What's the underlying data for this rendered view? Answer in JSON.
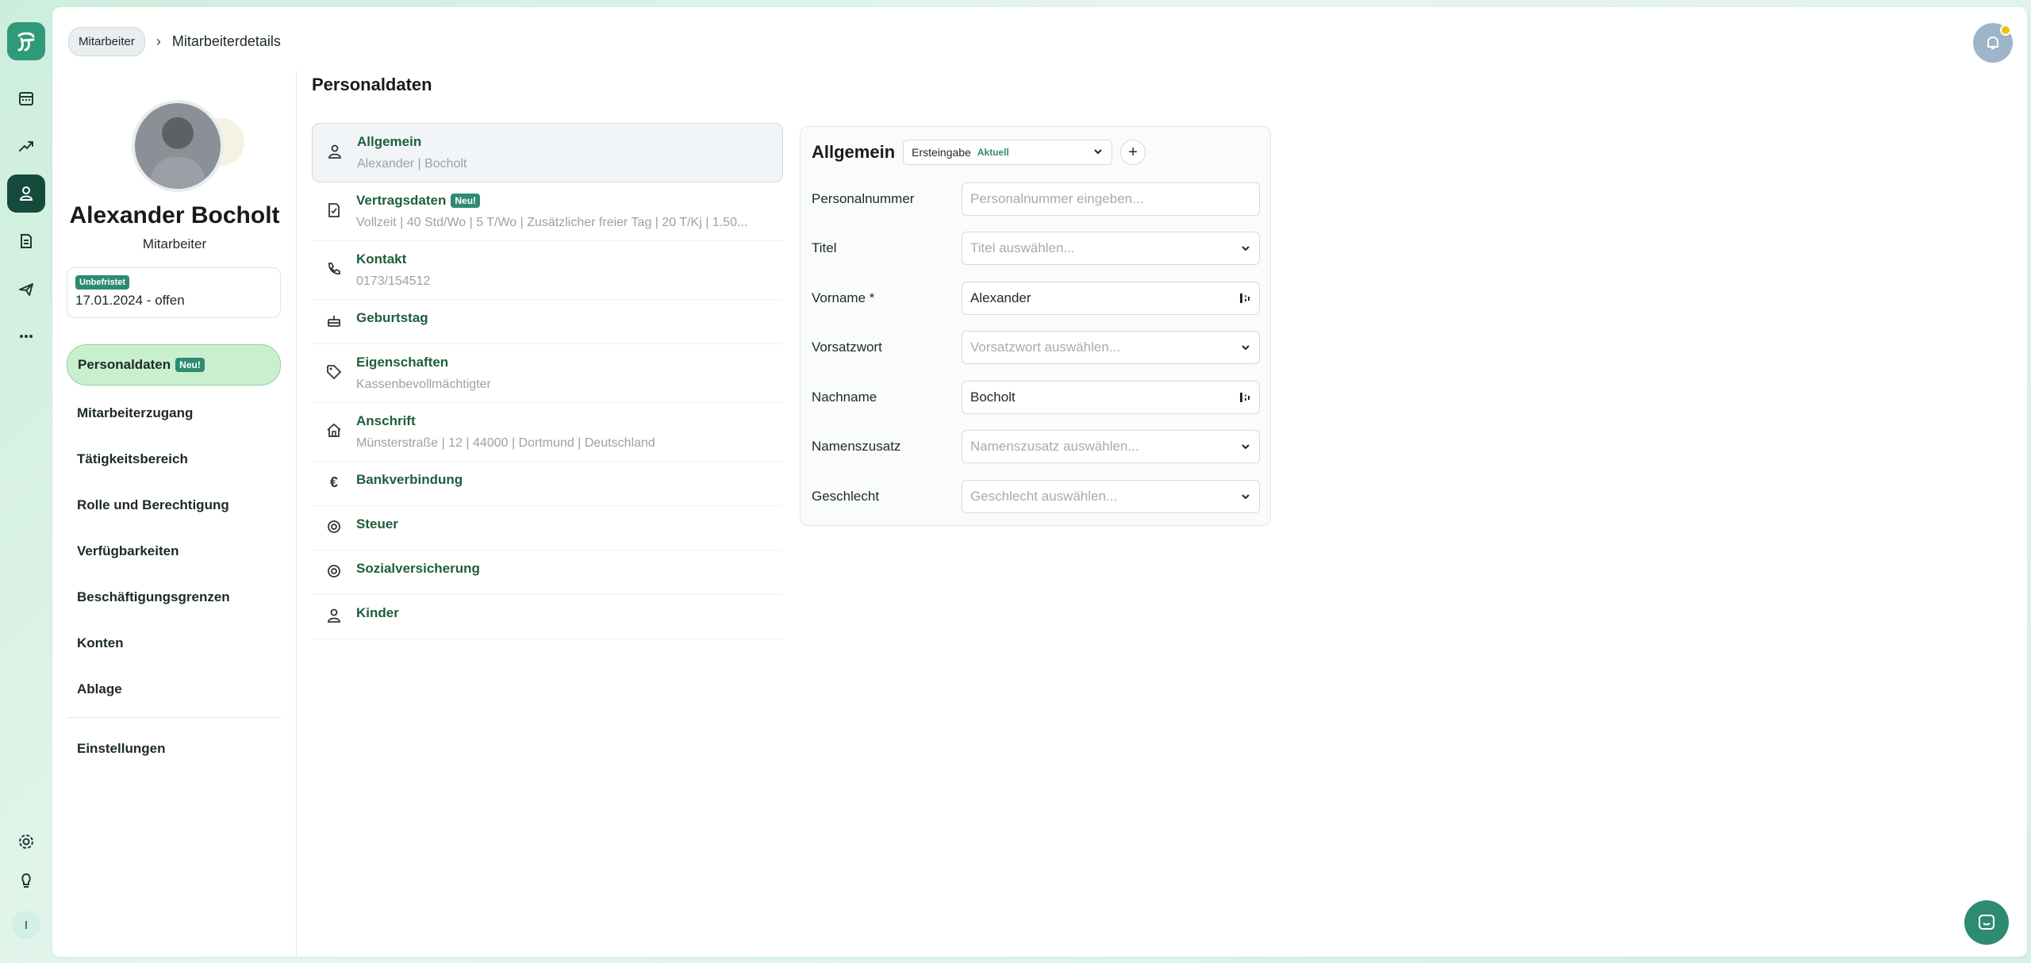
{
  "breadcrumb": {
    "parent": "Mitarbeiter",
    "separator": "›",
    "current": "Mitarbeiterdetails"
  },
  "rail": {
    "items": [
      "calendar-icon",
      "trending-icon",
      "user-icon",
      "document-icon",
      "plane-icon",
      "more-icon"
    ],
    "bottom": [
      "gear-icon",
      "lightbulb-icon"
    ],
    "user_initial": "I"
  },
  "profile": {
    "name": "Alexander Bocholt",
    "role": "Mitarbeiter",
    "contract_badge": "Unbefristet",
    "contract_dates": "17.01.2024 - offen"
  },
  "nav": {
    "active": "Personaldaten",
    "active_badge": "Neu!",
    "items": [
      "Mitarbeiterzugang",
      "Tätigkeitsbereich",
      "Rolle und Berechtigung",
      "Verfügbarkeiten",
      "Beschäftigungsgrenzen",
      "Konten",
      "Ablage"
    ],
    "settings": "Einstellungen"
  },
  "section": {
    "title": "Personaldaten",
    "rows": [
      {
        "title": "Allgemein",
        "subtitle": "Alexander | Bocholt"
      },
      {
        "title": "Vertragsdaten",
        "badge": "Neu!",
        "subtitle": "Vollzeit | 40 Std/Wo | 5 T/Wo | Zusätzlicher freier Tag | 20 T/Kj | 1.50..."
      },
      {
        "title": "Kontakt",
        "subtitle": "0173/154512"
      },
      {
        "title": "Geburtstag"
      },
      {
        "title": "Eigenschaften",
        "subtitle": "Kassenbevollmächtigter"
      },
      {
        "title": "Anschrift",
        "subtitle": "Münsterstraße | 12 | 44000 | Dortmund | Deutschland"
      },
      {
        "title": "Bankverbindung"
      },
      {
        "title": "Steuer"
      },
      {
        "title": "Sozialversicherung"
      },
      {
        "title": "Kinder"
      }
    ]
  },
  "panel": {
    "title": "Allgemein",
    "version_select": "Ersteingabe",
    "version_tag": "Aktuell",
    "add": "+",
    "fields": {
      "personalnummer": {
        "label": "Personalnummer",
        "placeholder": "Personalnummer eingeben..."
      },
      "titel": {
        "label": "Titel",
        "placeholder": "Titel auswählen..."
      },
      "vorname": {
        "label": "Vorname *",
        "value": "Alexander"
      },
      "vorsatzwort": {
        "label": "Vorsatzwort",
        "placeholder": "Vorsatzwort auswählen..."
      },
      "nachname": {
        "label": "Nachname",
        "value": "Bocholt"
      },
      "namenszusatz": {
        "label": "Namenszusatz",
        "placeholder": "Namenszusatz auswählen..."
      },
      "geschlecht": {
        "label": "Geschlecht",
        "placeholder": "Geschlecht auswählen..."
      }
    }
  },
  "colors": {
    "accent": "#2e8b72",
    "nav_active_bg": "#c8f0cf",
    "section_title": "#1f5e3b"
  }
}
